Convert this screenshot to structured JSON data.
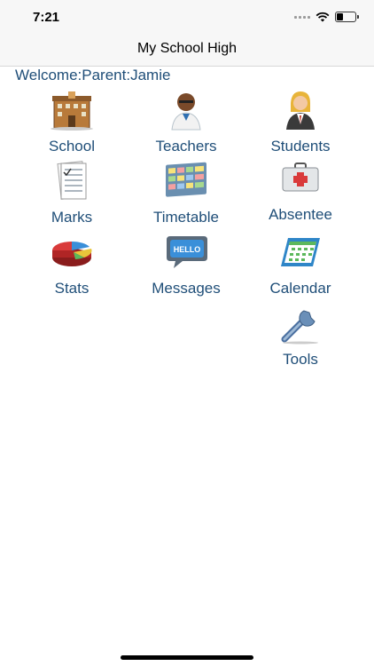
{
  "status": {
    "time": "7:21",
    "battery_level": 0.35
  },
  "nav": {
    "title": "My School High"
  },
  "welcome": "Welcome:Parent:Jamie",
  "tiles": [
    {
      "label": "School",
      "icon": "school-building-icon"
    },
    {
      "label": "Teachers",
      "icon": "teacher-icon"
    },
    {
      "label": "Students",
      "icon": "student-icon"
    },
    {
      "label": "Marks",
      "icon": "report-card-icon"
    },
    {
      "label": "Timetable",
      "icon": "timetable-icon"
    },
    {
      "label": "Absentee",
      "icon": "first-aid-kit-icon"
    },
    {
      "label": "Stats",
      "icon": "pie-chart-icon"
    },
    {
      "label": "Messages",
      "icon": "hello-speech-bubble-icon"
    },
    {
      "label": "Calendar",
      "icon": "calendar-icon"
    },
    {
      "label": "Tools",
      "icon": "wrench-icon"
    }
  ],
  "colors": {
    "label": "#1f4e78",
    "bar": "#f7f7f7"
  }
}
